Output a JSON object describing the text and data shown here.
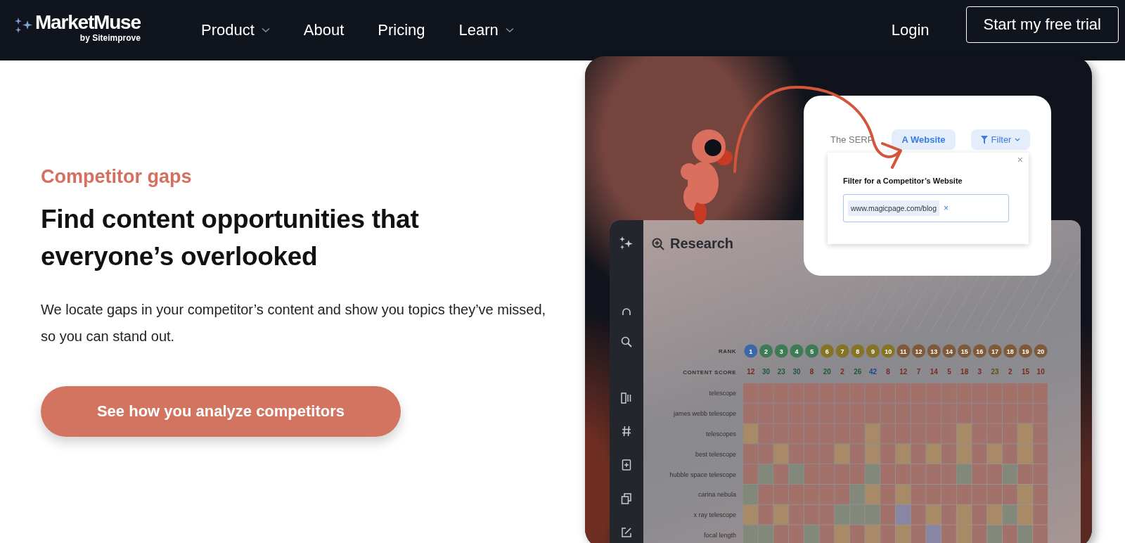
{
  "nav": {
    "logo": {
      "name": "MarketMuse",
      "byline": "by Siteimprove"
    },
    "items": [
      {
        "label": "Product",
        "has_menu": true
      },
      {
        "label": "About",
        "has_menu": false
      },
      {
        "label": "Pricing",
        "has_menu": false
      },
      {
        "label": "Learn",
        "has_menu": true
      }
    ],
    "login": "Login",
    "cta": "Start my free trial"
  },
  "hero": {
    "eyebrow": "Competitor gaps",
    "heading": "Find content opportunities that everyone’s overlooked",
    "body": "We locate gaps in your competitor’s content and show you topics they’ve missed, so you can stand out.",
    "button": "See how you analyze competitors"
  },
  "illustration": {
    "popup": {
      "tabs": [
        {
          "label": "The SERP",
          "kind": "tab",
          "selected": false
        },
        {
          "label": "A Website",
          "kind": "tab",
          "selected": true
        },
        {
          "label": "Filter",
          "kind": "filter",
          "selected": false
        }
      ],
      "close": "×",
      "panel_title": "Filter for a Competitor’s Website",
      "chip": "www.magicpage.com/blog",
      "chip_remove": "×"
    },
    "app": {
      "title": "Research",
      "rank_label": "RANK",
      "score_label": "CONTENT SCORE",
      "ranks": [
        {
          "label": "1",
          "color": "#3d68a8"
        },
        {
          "label": "2",
          "color": "#3e7a55"
        },
        {
          "label": "3",
          "color": "#3e7a55"
        },
        {
          "label": "4",
          "color": "#3e7a55"
        },
        {
          "label": "5",
          "color": "#3e7a55"
        },
        {
          "label": "6",
          "color": "#857326"
        },
        {
          "label": "7",
          "color": "#857326"
        },
        {
          "label": "8",
          "color": "#857326"
        },
        {
          "label": "9",
          "color": "#857326"
        },
        {
          "label": "10",
          "color": "#857326"
        },
        {
          "label": "11",
          "color": "#7e5a3a"
        },
        {
          "label": "12",
          "color": "#7e5a3a"
        },
        {
          "label": "13",
          "color": "#7e5a3a"
        },
        {
          "label": "14",
          "color": "#7e5a3a"
        },
        {
          "label": "15",
          "color": "#7e5a3a"
        },
        {
          "label": "16",
          "color": "#7e5a3a"
        },
        {
          "label": "17",
          "color": "#7e5a3a"
        },
        {
          "label": "18",
          "color": "#7e5a3a"
        },
        {
          "label": "19",
          "color": "#7e5a3a"
        },
        {
          "label": "20",
          "color": "#7e5a3a"
        }
      ],
      "scores": [
        {
          "label": "12",
          "color": "#7a2a1e"
        },
        {
          "label": "30",
          "color": "#1f5a34"
        },
        {
          "label": "23",
          "color": "#1f5a34"
        },
        {
          "label": "30",
          "color": "#1f5a34"
        },
        {
          "label": "8",
          "color": "#7a2a1e"
        },
        {
          "label": "20",
          "color": "#1f5a34"
        },
        {
          "label": "2",
          "color": "#7a2a1e"
        },
        {
          "label": "26",
          "color": "#1f5a34"
        },
        {
          "label": "42",
          "color": "#1d4a8c"
        },
        {
          "label": "8",
          "color": "#7a2a1e"
        },
        {
          "label": "12",
          "color": "#7a2a1e"
        },
        {
          "label": "7",
          "color": "#7a2a1e"
        },
        {
          "label": "14",
          "color": "#7a2a1e"
        },
        {
          "label": "5",
          "color": "#7a2a1e"
        },
        {
          "label": "18",
          "color": "#7a2a1e"
        },
        {
          "label": "3",
          "color": "#7a2a1e"
        },
        {
          "label": "23",
          "color": "#5e5010"
        },
        {
          "label": "2",
          "color": "#7a2a1e"
        },
        {
          "label": "15",
          "color": "#7a2a1e"
        },
        {
          "label": "10",
          "color": "#7a2a1e"
        }
      ],
      "rows": [
        {
          "label": "telescope",
          "cells": [
            {
              "color": "#a2716a"
            },
            {
              "color": "#a2716a"
            },
            {
              "color": "#a2716a"
            },
            {
              "color": "#a2716a"
            },
            {
              "color": "#a2716a"
            },
            {
              "color": "#a2716a"
            },
            {
              "color": "#a2716a"
            },
            {
              "color": "#a2716a"
            },
            {
              "color": "#a2716a"
            },
            {
              "color": "#a2716a"
            },
            {
              "color": "#a2716a"
            },
            {
              "color": "#a2716a"
            },
            {
              "color": "#a2716a"
            },
            {
              "color": "#a2716a"
            },
            {
              "color": "#a2716a"
            },
            {
              "color": "#a2716a"
            },
            {
              "color": "#a2716a"
            },
            {
              "color": "#a2716a"
            },
            {
              "color": "#a2716a"
            },
            {
              "color": "#a2716a"
            }
          ]
        },
        {
          "label": "james webb telescope",
          "cells": [
            {
              "color": "#a2716a"
            },
            {
              "color": "#a2716a"
            },
            {
              "color": "#a2716a"
            },
            {
              "color": "#a2716a"
            },
            {
              "color": "#a2716a"
            },
            {
              "color": "#a2716a"
            },
            {
              "color": "#a2716a"
            },
            {
              "color": "#a2716a"
            },
            {
              "color": "#a2716a"
            },
            {
              "color": "#a2716a"
            },
            {
              "color": "#a2716a"
            },
            {
              "color": "#a2716a"
            },
            {
              "color": "#a2716a"
            },
            {
              "color": "#a2716a"
            },
            {
              "color": "#a2716a"
            },
            {
              "color": "#a2716a"
            },
            {
              "color": "#a2716a"
            },
            {
              "color": "#a2716a"
            },
            {
              "color": "#a2716a"
            },
            {
              "color": "#a2716a"
            }
          ]
        },
        {
          "label": "telescopes",
          "cells": [
            {
              "color": "#a88a66"
            },
            {
              "color": "#a2716a"
            },
            {
              "color": "#a2716a"
            },
            {
              "color": "#a2716a"
            },
            {
              "color": "#a2716a"
            },
            {
              "color": "#a2716a"
            },
            {
              "color": "#a2716a"
            },
            {
              "color": "#a2716a"
            },
            {
              "color": "#a88a66"
            },
            {
              "color": "#a2716a"
            },
            {
              "color": "#a2716a"
            },
            {
              "color": "#a2716a"
            },
            {
              "color": "#a2716a"
            },
            {
              "color": "#a2716a"
            },
            {
              "color": "#a88a66"
            },
            {
              "color": "#a2716a"
            },
            {
              "color": "#a2716a"
            },
            {
              "color": "#a2716a"
            },
            {
              "color": "#a88a66"
            },
            {
              "color": "#a2716a"
            }
          ]
        },
        {
          "label": "best telescope",
          "cells": [
            {
              "color": "#a2716a"
            },
            {
              "color": "#a2716a"
            },
            {
              "color": "#a88a66"
            },
            {
              "color": "#a2716a"
            },
            {
              "color": "#a2716a"
            },
            {
              "color": "#a2716a"
            },
            {
              "color": "#a88a66"
            },
            {
              "color": "#a2716a"
            },
            {
              "color": "#a88a66"
            },
            {
              "color": "#a2716a"
            },
            {
              "color": "#a88a66"
            },
            {
              "color": "#a2716a"
            },
            {
              "color": "#a88a66"
            },
            {
              "color": "#a2716a"
            },
            {
              "color": "#a88a66"
            },
            {
              "color": "#a2716a"
            },
            {
              "color": "#a88a66"
            },
            {
              "color": "#a2716a"
            },
            {
              "color": "#a88a66"
            },
            {
              "color": "#a2716a"
            }
          ]
        },
        {
          "label": "hubble space telescope",
          "cells": [
            {
              "color": "#a2716a"
            },
            {
              "color": "#82897a"
            },
            {
              "color": "#a2716a"
            },
            {
              "color": "#82897a"
            },
            {
              "color": "#a2716a"
            },
            {
              "color": "#a2716a"
            },
            {
              "color": "#a2716a"
            },
            {
              "color": "#a2716a"
            },
            {
              "color": "#82897a"
            },
            {
              "color": "#a2716a"
            },
            {
              "color": "#a2716a"
            },
            {
              "color": "#a2716a"
            },
            {
              "color": "#a2716a"
            },
            {
              "color": "#a2716a"
            },
            {
              "color": "#82897a"
            },
            {
              "color": "#a2716a"
            },
            {
              "color": "#a2716a"
            },
            {
              "color": "#82897a"
            },
            {
              "color": "#a2716a"
            },
            {
              "color": "#a2716a"
            }
          ]
        },
        {
          "label": "carina nebula",
          "cells": [
            {
              "color": "#82897a"
            },
            {
              "color": "#a2716a"
            },
            {
              "color": "#a2716a"
            },
            {
              "color": "#a2716a"
            },
            {
              "color": "#a2716a"
            },
            {
              "color": "#a2716a"
            },
            {
              "color": "#a2716a"
            },
            {
              "color": "#82897a"
            },
            {
              "color": "#a88a66"
            },
            {
              "color": "#a2716a"
            },
            {
              "color": "#a88a66"
            },
            {
              "color": "#a2716a"
            },
            {
              "color": "#a2716a"
            },
            {
              "color": "#a2716a"
            },
            {
              "color": "#a2716a"
            },
            {
              "color": "#a2716a"
            },
            {
              "color": "#a2716a"
            },
            {
              "color": "#a2716a"
            },
            {
              "color": "#a88a66"
            },
            {
              "color": "#a2716a"
            }
          ]
        },
        {
          "label": "x ray telescope",
          "cells": [
            {
              "color": "#a88a66"
            },
            {
              "color": "#a2716a"
            },
            {
              "color": "#a88a66"
            },
            {
              "color": "#a2716a"
            },
            {
              "color": "#a2716a"
            },
            {
              "color": "#a2716a"
            },
            {
              "color": "#82897a"
            },
            {
              "color": "#82897a"
            },
            {
              "color": "#82897a"
            },
            {
              "color": "#a2716a"
            },
            {
              "color": "#8886a4"
            },
            {
              "color": "#a2716a"
            },
            {
              "color": "#a88a66"
            },
            {
              "color": "#a2716a"
            },
            {
              "color": "#a88a66"
            },
            {
              "color": "#a2716a"
            },
            {
              "color": "#a88a66"
            },
            {
              "color": "#82897a"
            },
            {
              "color": "#a88a66"
            },
            {
              "color": "#a2716a"
            }
          ]
        },
        {
          "label": "focal length",
          "cells": [
            {
              "color": "#82897a"
            },
            {
              "color": "#82897a"
            },
            {
              "color": "#a2716a"
            },
            {
              "color": "#a2716a"
            },
            {
              "color": "#82897a"
            },
            {
              "color": "#a2716a"
            },
            {
              "color": "#a88a66"
            },
            {
              "color": "#a2716a"
            },
            {
              "color": "#a88a66"
            },
            {
              "color": "#a2716a"
            },
            {
              "color": "#a88a66"
            },
            {
              "color": "#a2716a"
            },
            {
              "color": "#8886a4"
            },
            {
              "color": "#a2716a"
            },
            {
              "color": "#a88a66"
            },
            {
              "color": "#a2716a"
            },
            {
              "color": "#82897a"
            },
            {
              "color": "#a2716a"
            },
            {
              "color": "#82897a"
            },
            {
              "color": "#a2716a"
            }
          ]
        }
      ]
    }
  }
}
